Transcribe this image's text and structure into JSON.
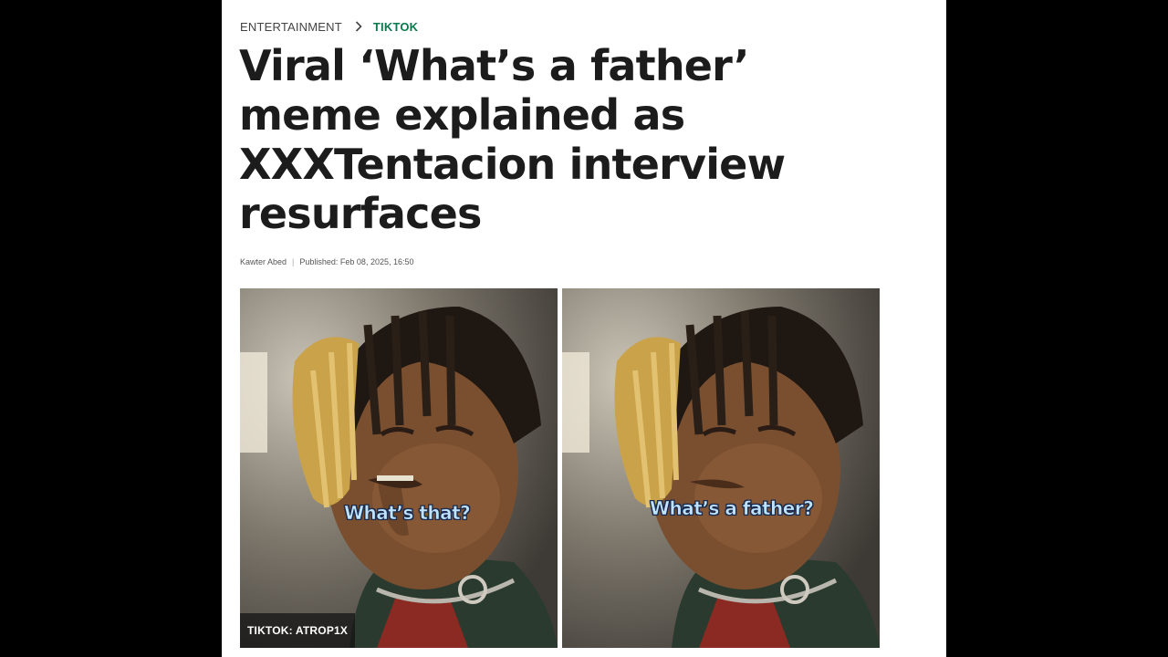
{
  "breadcrumb": {
    "section": "ENTERTAINMENT",
    "subsection": "TIKTOK"
  },
  "article": {
    "title": "Viral ‘What’s a father’ meme explained as XXXTentacion interview resurfaces",
    "author": "Kawter Abed",
    "published": "Published: Feb 08, 2025, 16:50"
  },
  "images": {
    "left_caption": "What’s that?",
    "right_caption": "What’s a father?",
    "credit": "TIKTOK: ATROP1X"
  },
  "colors": {
    "accent": "#0a7a4c",
    "title": "#1c1c1c",
    "caption": "#bfe3ff"
  }
}
